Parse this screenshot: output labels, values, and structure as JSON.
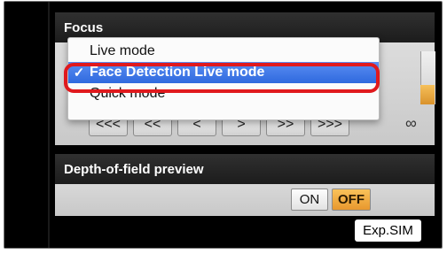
{
  "focus": {
    "header": "Focus",
    "menu_items": [
      {
        "label": "Live mode",
        "checked": false
      },
      {
        "label": "Face Detection Live mode",
        "checked": true,
        "check_glyph": "✓"
      },
      {
        "label": "Quick mode",
        "checked": false
      }
    ],
    "nav_buttons": [
      "<<<",
      "<<",
      "<",
      ">",
      ">>",
      ">>>"
    ],
    "infinity_label": "∞"
  },
  "dof": {
    "header": "Depth-of-field preview",
    "on_label": "ON",
    "off_label": "OFF"
  },
  "exp_sim": "Exp.SIM",
  "colors": {
    "selected_item": "#3a74e6",
    "highlight_ring": "#e0191d",
    "off_active": "#f0a93e"
  }
}
